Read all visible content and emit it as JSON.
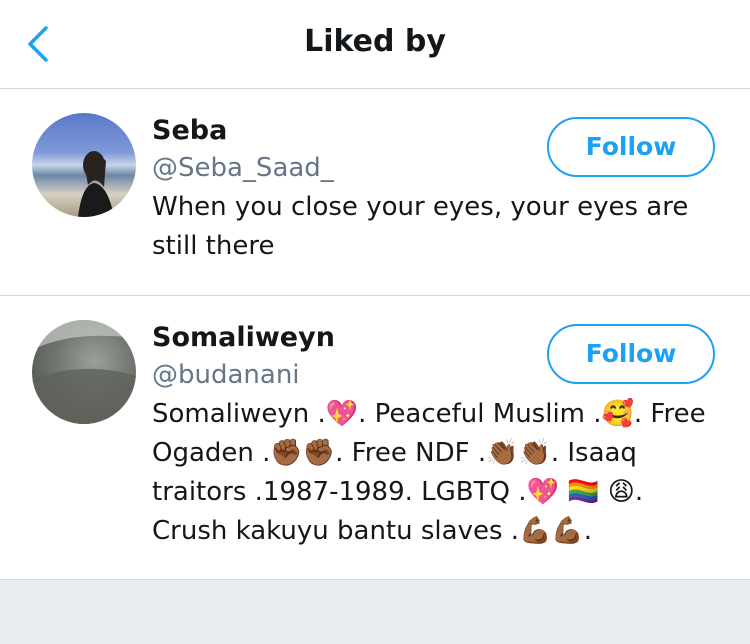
{
  "header": {
    "title": "Liked by",
    "back_icon": "chevron-left-icon"
  },
  "users": [
    {
      "name": "Seba",
      "handle": "@Seba_Saad_",
      "bio": "When you close your eyes, your eyes are still there",
      "follow_label": "Follow"
    },
    {
      "name": "Somaliweyn",
      "handle": "@budanani",
      "bio": "Somaliweyn .💖. Peaceful Muslim .🥰. Free Ogaden .✊🏾✊🏾. Free NDF .👏🏾👏🏾. Isaaq traitors .1987-1989. LGBTQ .💖 🏳️‍🌈 😩. Crush kakuyu bantu slaves .💪🏾💪🏾.",
      "follow_label": "Follow"
    }
  ],
  "colors": {
    "accent": "#1da1f2",
    "handle": "#657786",
    "text": "#14171a",
    "divider": "#cfd6dc",
    "background": "#e6ecf0"
  }
}
